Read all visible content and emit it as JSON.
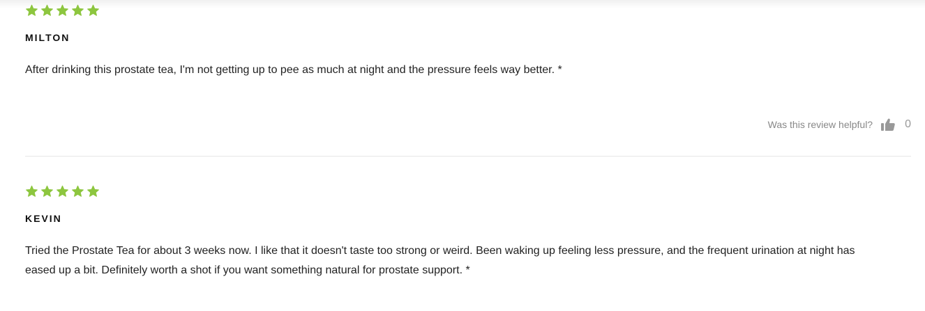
{
  "colors": {
    "star": "#8dc63f",
    "divider": "#e6e6e6",
    "muted_text": "#888888"
  },
  "icons": {
    "star": "star-icon",
    "helpful": "thumbs-up-icon"
  },
  "reviews": [
    {
      "rating": 5,
      "name": "MILTON",
      "body": "After drinking this prostate tea, I'm not getting up to pee as much at night and the pressure feels way better. *",
      "helpful_label": "Was this review helpful?",
      "helpful_count": "0"
    },
    {
      "rating": 5,
      "name": "KEVIN",
      "body": "Tried the Prostate Tea for about 3 weeks now. I like that it doesn't taste too strong or weird. Been waking up feeling less pressure, and the frequent urination at night has eased up a bit. Definitely worth a shot if you want something natural for prostate support. *"
    }
  ]
}
